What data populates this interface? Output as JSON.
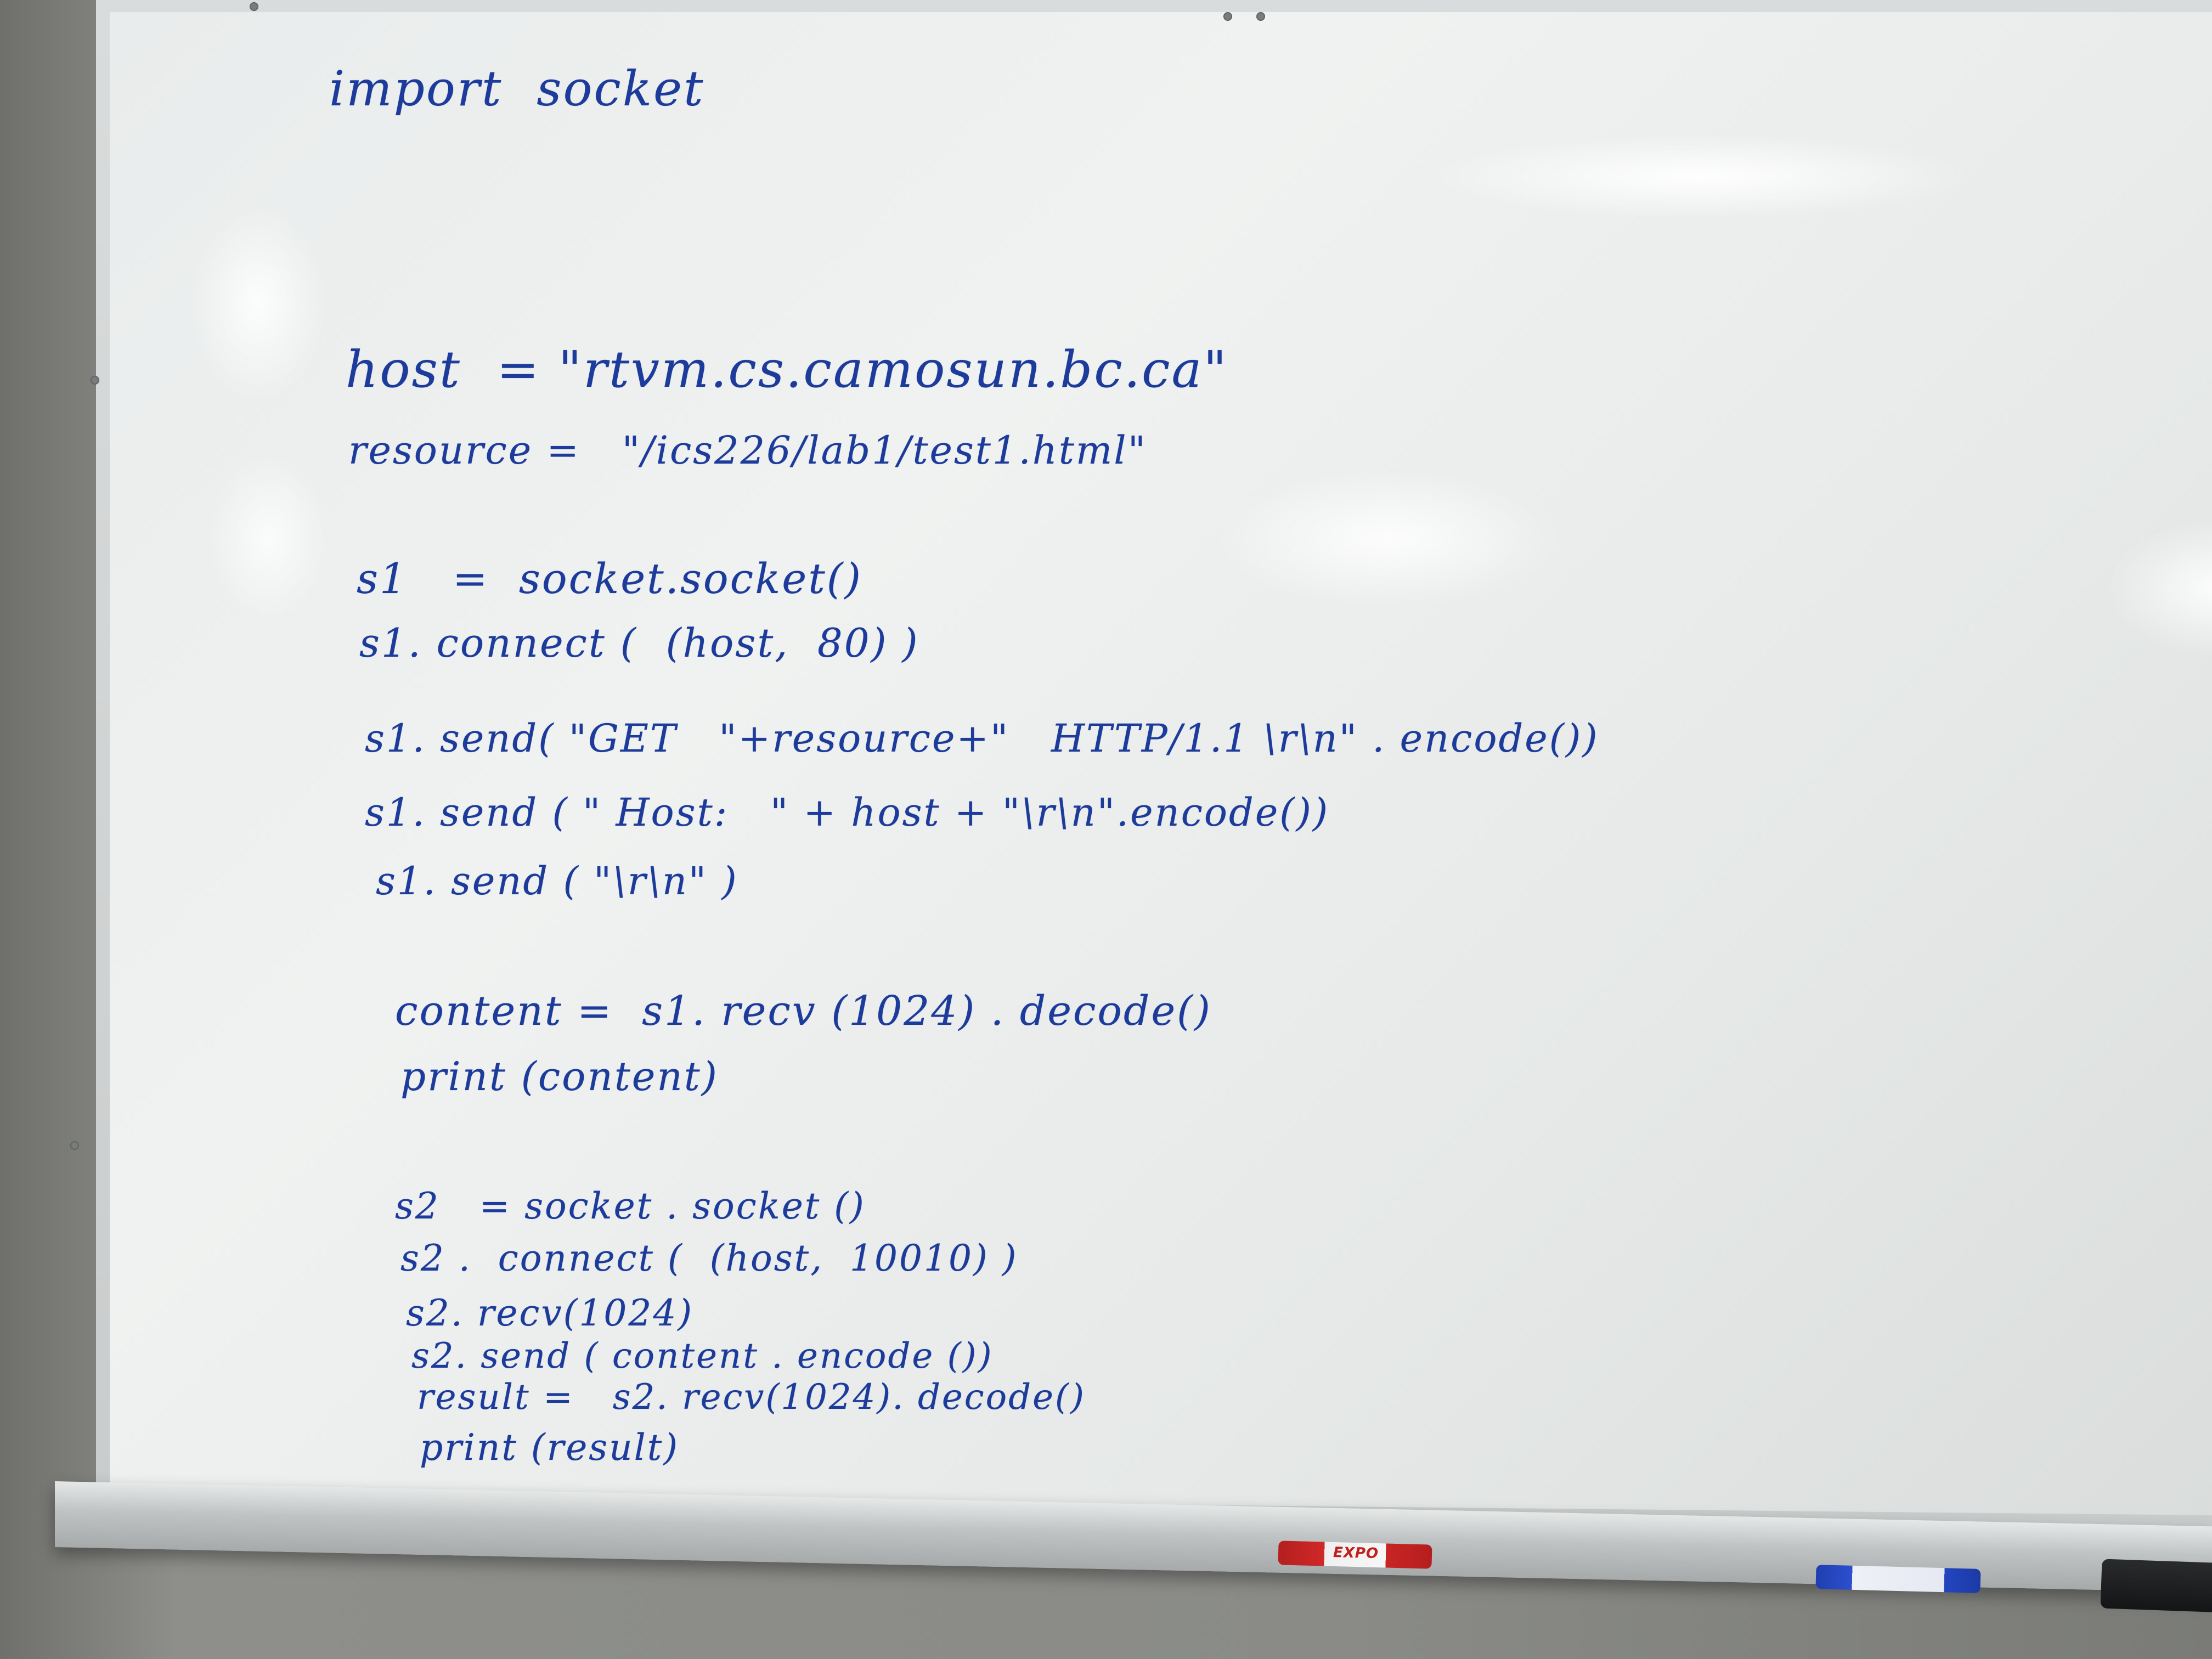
{
  "whiteboard": {
    "lines": [
      "import  socket",
      "host  = \"rtvm.cs.camosun.bc.ca\"",
      "resource =   \"/ics226/lab1/test1.html\"",
      "s1   =  socket.socket()",
      "s1. connect (  (host,  80) )",
      "s1. send( \"GET   \"+resource+\"   HTTP/1.1 \\r\\n\" . encode())",
      "s1. send ( \" Host:   \" + host + \"\\r\\n\".encode())",
      "s1. send ( \"\\r\\n\" )",
      "content =  s1. recv (1024) . decode()",
      "print (content)",
      "s2   = socket . socket ()",
      "s2 .  connect (  (host,  10010) )",
      "s2. recv(1024)",
      "s2. send ( content . encode ())",
      "result =   s2. recv(1024). decode()",
      "print (result)"
    ]
  },
  "tray": {
    "red_marker_brand": "EXPO"
  },
  "colors": {
    "ink": "#1c3b9b",
    "board": "#eceeee",
    "wall": "#8a8b87"
  }
}
